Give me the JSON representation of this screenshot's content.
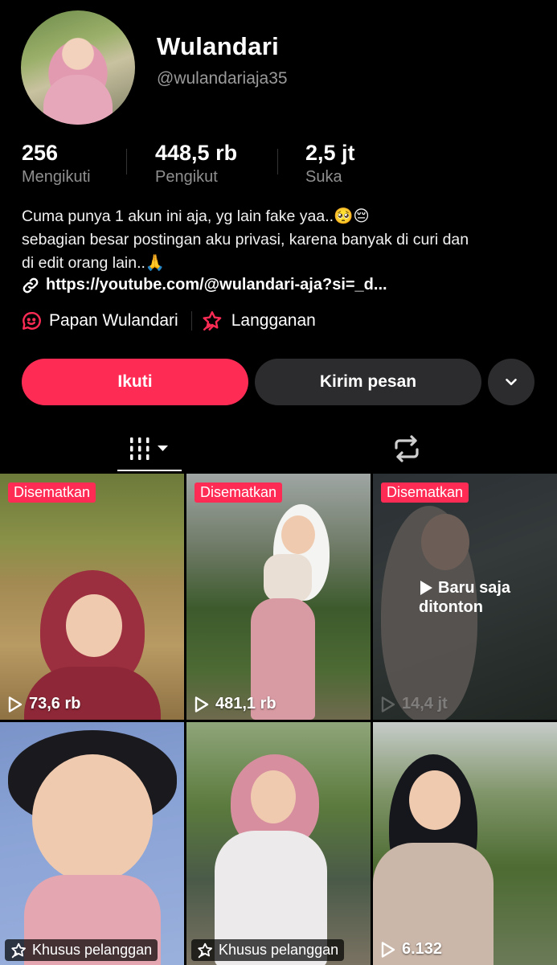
{
  "profile": {
    "name": "Wulandari",
    "handle": "@wulandariaja35",
    "stats": [
      {
        "value": "256",
        "label": "Mengikuti"
      },
      {
        "value": "448,5 rb",
        "label": "Pengikut"
      },
      {
        "value": "2,5 jt",
        "label": "Suka"
      }
    ],
    "bio_line1": "Cuma punya 1 akun ini aja, yg lain fake yaa..🥺😔",
    "bio_line2": "sebagian besar postingan aku privasi, karena banyak di curi dan",
    "bio_line3": "di edit orang lain..🙏",
    "link": "https://youtube.com/@wulandari-aja?si=_d...",
    "chip_board": "Papan Wulandari",
    "chip_subscription": "Langganan"
  },
  "actions": {
    "follow": "Ikuti",
    "message": "Kirim pesan"
  },
  "colors": {
    "accent": "#fe2c55",
    "secondary_button": "#2c2c2e",
    "muted_text": "#8f8f8f"
  },
  "videos": [
    {
      "badge": "Disematkan",
      "views": "73,6 rb"
    },
    {
      "badge": "Disematkan",
      "views": "481,1 rb"
    },
    {
      "badge": "Disematkan",
      "views": "14,4 jt",
      "overlay_line1": "Baru saja",
      "overlay_line2": "ditonton"
    },
    {
      "subscriber_label": "Khusus pelanggan"
    },
    {
      "subscriber_label": "Khusus pelanggan"
    },
    {
      "views": "6.132"
    }
  ]
}
